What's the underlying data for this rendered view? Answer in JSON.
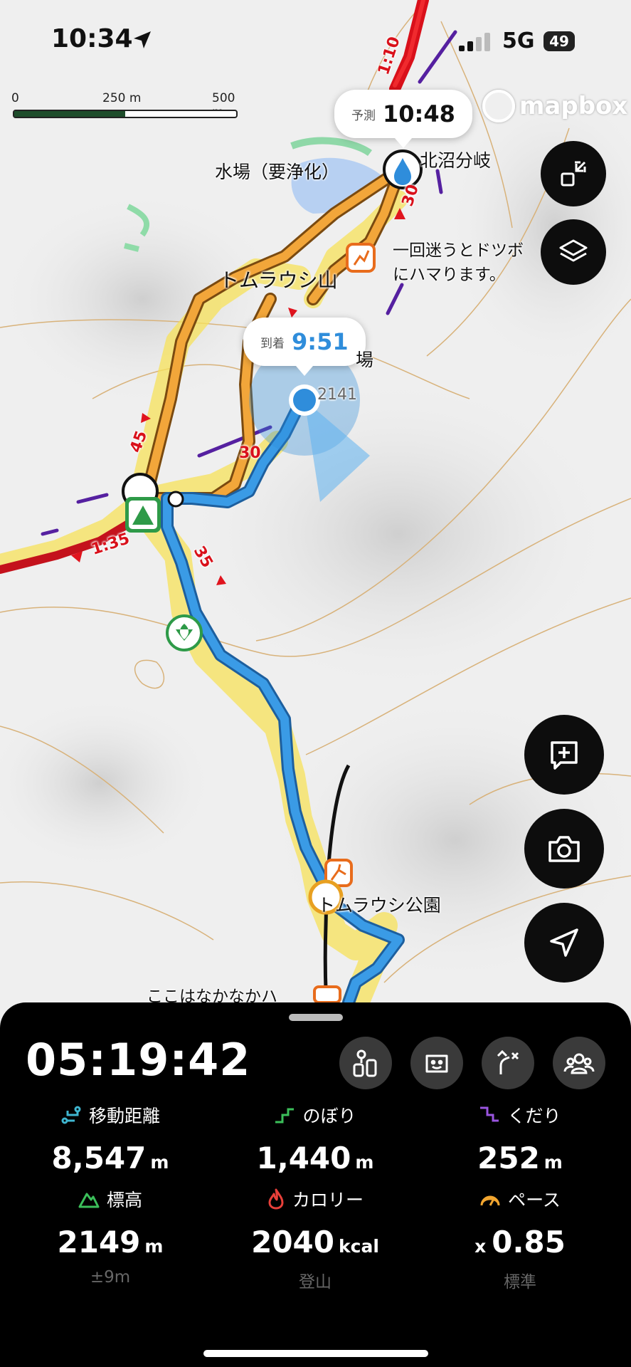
{
  "status_bar": {
    "time": "10:34",
    "network": "5G",
    "battery": "49"
  },
  "map": {
    "scale": {
      "label_0": "0",
      "label_250": "250 m",
      "label_500": "500 m"
    },
    "brand": "mapbox",
    "forecast_bubble": {
      "label": "予測",
      "time": "10:48"
    },
    "arrival_bubble": {
      "label": "到着",
      "time": "9:51"
    },
    "labels": {
      "water": "水場（要浄化）",
      "junction": "北沼分岐",
      "note_line1": "一回迷うとドツボ",
      "note_line2": "にハマります。",
      "peak": "トムラウシ山",
      "camp": "場",
      "elevation": "2141",
      "park": "トムラウシ公園",
      "note2": "ここはなかなかハ"
    },
    "segment_times": {
      "t1": "1:10",
      "t2": "30",
      "t3": "45",
      "t4": "30",
      "t5": "1:35",
      "t6": "35"
    },
    "colors": {
      "track": "#2f8ddb",
      "route": "#f0a530",
      "trail": "#d9101a",
      "halo": "#f7e25a"
    }
  },
  "panel": {
    "elapsed": "05:19:42",
    "stats": [
      {
        "label": "移動距離",
        "value": "8,547",
        "unit": "m",
        "sub": "",
        "icon": "distance-icon"
      },
      {
        "label": "のぼり",
        "value": "1,440",
        "unit": "m",
        "sub": "",
        "icon": "ascent-icon"
      },
      {
        "label": "くだり",
        "value": "252",
        "unit": "m",
        "sub": "",
        "icon": "descent-icon"
      },
      {
        "label": "標高",
        "value": "2149",
        "unit": "m",
        "sub": "±9m",
        "icon": "mountain-icon"
      },
      {
        "label": "カロリー",
        "value": "2040",
        "unit": "kcal",
        "sub": "登山",
        "icon": "flame-icon"
      },
      {
        "label": "ペース",
        "prefix": "x",
        "value": "0.85",
        "unit": "",
        "sub": "標準",
        "icon": "gauge-icon"
      }
    ]
  }
}
